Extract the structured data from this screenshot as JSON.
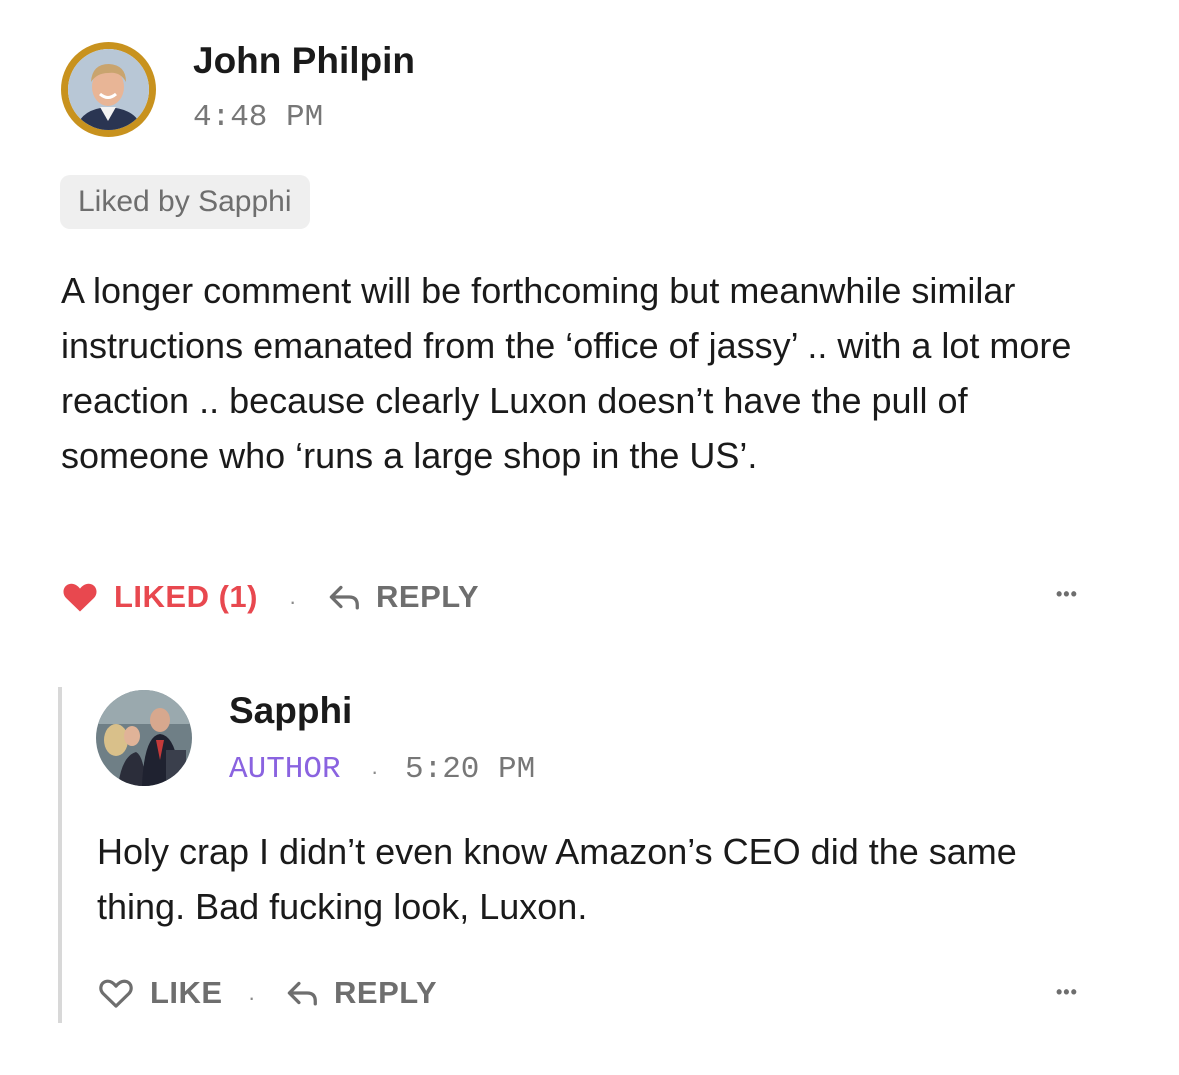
{
  "comment": {
    "author": "John Philpin",
    "time": "4:48 PM",
    "liked_by": "Liked by Sapphi",
    "text": "A longer comment will be forthcoming but meanwhile similar instructions emanated from the ‘office of jassy’ .. with a lot more reaction .. because clearly Luxon doesn’t have the pull of someone who ‘runs a large shop in the US’.",
    "like_label": "LIKED (1)",
    "separator": "·",
    "reply_label": "REPLY",
    "more": "•••",
    "avatar_icon": "profile-photo",
    "colors": {
      "liked": "#e8484f",
      "avatar_ring": "#c8921e"
    }
  },
  "reply": {
    "author": "Sapphi",
    "role": "AUTHOR",
    "separator": "·",
    "time": "5:20 PM",
    "text": "Holy crap I didn’t even know Amazon’s CEO did the same thing. Bad fucking look, Luxon.",
    "like_label": "LIKE",
    "reply_label": "REPLY",
    "more": "•••",
    "avatar_icon": "profile-photo",
    "colors": {
      "role": "#8a63e0"
    }
  }
}
